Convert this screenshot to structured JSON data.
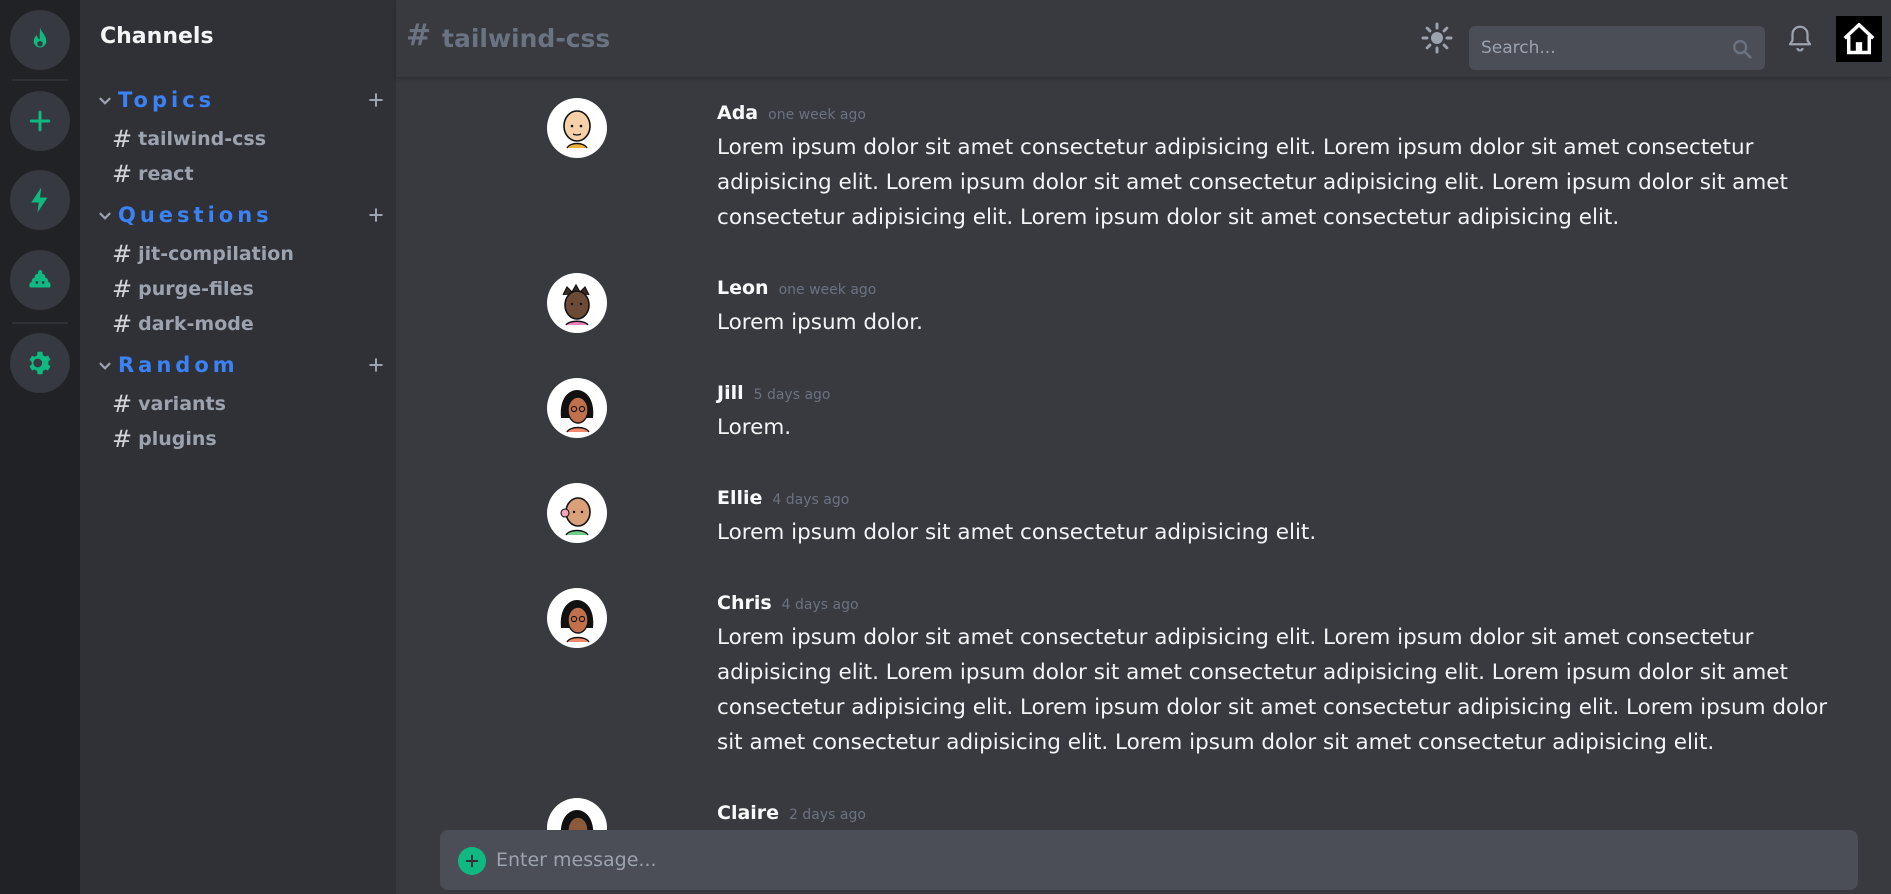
{
  "rail": {
    "items": [
      {
        "icon": "flame-icon"
      },
      {
        "icon": "plus-icon"
      },
      {
        "icon": "bolt-icon"
      },
      {
        "icon": "poo-icon"
      },
      {
        "icon": "gear-icon"
      }
    ],
    "accent": "#10b981"
  },
  "sidebar": {
    "title": "Channels",
    "categories": [
      {
        "label": "Topics",
        "channels": [
          "tailwind-css",
          "react"
        ]
      },
      {
        "label": "Questions",
        "channels": [
          "jit-compilation",
          "purge-files",
          "dark-mode"
        ]
      },
      {
        "label": "Random",
        "channels": [
          "variants",
          "plugins"
        ]
      }
    ],
    "hash": "#",
    "category_color": "#3b82f6"
  },
  "header": {
    "hash": "#",
    "channel": "tailwind-css",
    "search_placeholder": "Search..."
  },
  "messages": [
    {
      "author": "Ada",
      "time": "one week ago",
      "text": "Lorem ipsum dolor sit amet consectetur adipisicing elit. Lorem ipsum dolor sit amet consectetur adipisicing elit. Lorem ipsum dolor sit amet consectetur adipisicing elit. Lorem ipsum dolor sit amet consectetur adipisicing elit. Lorem ipsum dolor sit amet consectetur adipisicing elit."
    },
    {
      "author": "Leon",
      "time": "one week ago",
      "text": "Lorem ipsum dolor."
    },
    {
      "author": "Jill",
      "time": "5 days ago",
      "text": "Lorem."
    },
    {
      "author": "Ellie",
      "time": "4 days ago",
      "text": "Lorem ipsum dolor sit amet consectetur adipisicing elit."
    },
    {
      "author": "Chris",
      "time": "4 days ago",
      "text": "Lorem ipsum dolor sit amet consectetur adipisicing elit. Lorem ipsum dolor sit amet consectetur adipisicing elit. Lorem ipsum dolor sit amet consectetur adipisicing elit. Lorem ipsum dolor sit amet consectetur adipisicing elit. Lorem ipsum dolor sit amet consectetur adipisicing elit. Lorem ipsum dolor sit amet consectetur adipisicing elit. Lorem ipsum dolor sit amet consectetur adipisicing elit."
    },
    {
      "author": "Claire",
      "time": "2 days ago",
      "text": ""
    }
  ],
  "composer": {
    "placeholder": "Enter message..."
  }
}
